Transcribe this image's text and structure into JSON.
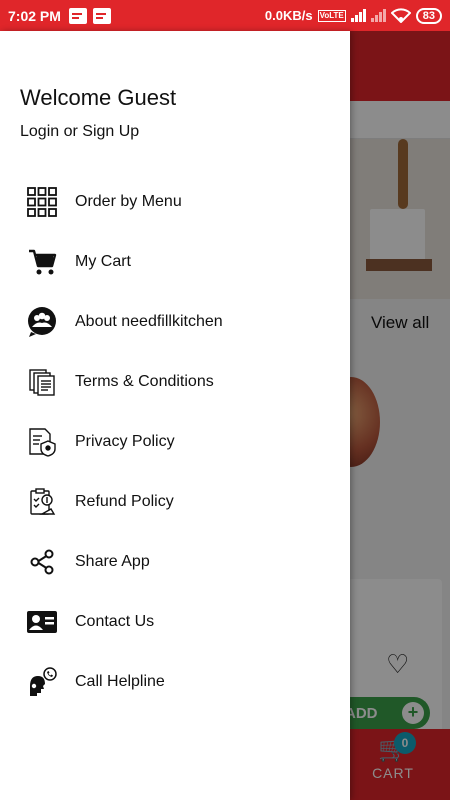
{
  "status_bar": {
    "time": "7:02 PM",
    "net_speed": "0.0KB/s",
    "volte": "VoLTE",
    "battery": "83"
  },
  "background": {
    "view_all": "View all",
    "add_label": "ADD",
    "cart_label": "CART",
    "cart_count": "0"
  },
  "drawer": {
    "title": "Welcome Guest",
    "subtitle": "Login or Sign Up",
    "items": [
      {
        "label": "Order by Menu",
        "icon": "grid-menu-icon"
      },
      {
        "label": "My Cart",
        "icon": "shopping-cart-icon"
      },
      {
        "label": "About needfillkitchen",
        "icon": "group-chat-icon"
      },
      {
        "label": "Terms & Conditions",
        "icon": "documents-icon"
      },
      {
        "label": "Privacy Policy",
        "icon": "privacy-document-icon"
      },
      {
        "label": "Refund Policy",
        "icon": "refund-document-icon"
      },
      {
        "label": "Share App",
        "icon": "share-icon"
      },
      {
        "label": "Contact Us",
        "icon": "contact-card-icon"
      },
      {
        "label": "Call Helpline",
        "icon": "helpline-icon"
      }
    ]
  },
  "colors": {
    "brand_red": "#e0262a",
    "add_green": "#3ba14a",
    "cart_badge": "#17a7c4"
  }
}
